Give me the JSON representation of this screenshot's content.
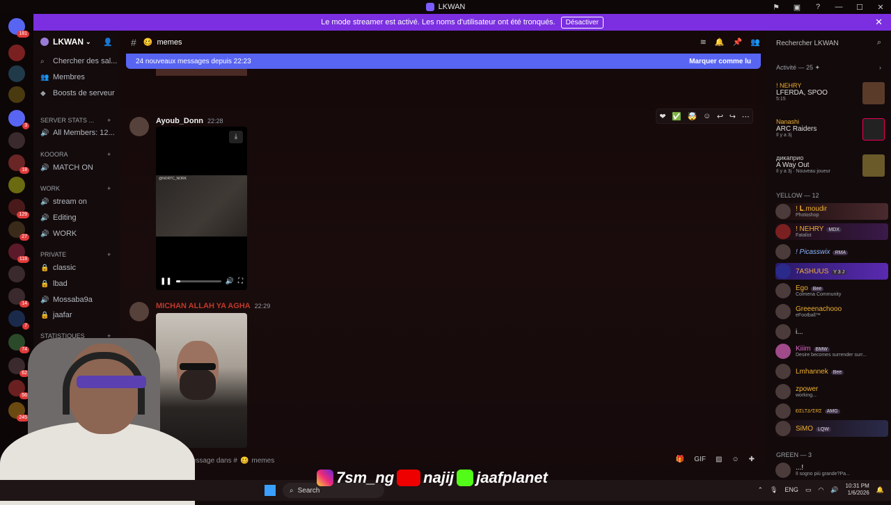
{
  "window": {
    "title": "LKWAN"
  },
  "banner": {
    "text": "Le mode streamer est activé. Les noms d'utilisateur ont été tronqués.",
    "button": "Désactiver"
  },
  "servers": [
    {
      "badge": "181"
    },
    {
      "badge": ""
    },
    {
      "badge": ""
    },
    {
      "badge": ""
    },
    {
      "badge": "3"
    },
    {
      "badge": ""
    },
    {
      "badge": "18"
    },
    {
      "badge": ""
    },
    {
      "badge": "129"
    },
    {
      "badge": "27"
    },
    {
      "badge": "118"
    },
    {
      "badge": ""
    },
    {
      "badge": "14"
    },
    {
      "badge": "7"
    },
    {
      "badge": "74"
    },
    {
      "badge": "62"
    },
    {
      "badge": "56"
    },
    {
      "badge": "245"
    }
  ],
  "guild": {
    "name": "LKWAN"
  },
  "sidebar": {
    "items": [
      {
        "label": "Chercher des sal..."
      },
      {
        "label": "Membres"
      },
      {
        "label": "Boosts de serveur"
      }
    ],
    "server_stats": "SERVER STATS ...",
    "all_members": "All Members: 12...",
    "kooora": "KOOORA",
    "match_on": "MATCH ON",
    "work": "work",
    "stream_on": "stream on",
    "editing": "Editing",
    "work_ch": "WORK",
    "private": "PRIVATE",
    "classic": "classic",
    "lbad": "lbad",
    "mossaba": "Mossaba9a",
    "jaafar": "jaafar",
    "statistiques": "STATISTIQUES"
  },
  "channel": {
    "name": "memes",
    "new_messages": "24 nouveaux messages depuis 22:23",
    "mark_read": "Marquer comme lu"
  },
  "messages": [
    {
      "author": "Ayoub_Donn",
      "time": "22:28",
      "video_watermark": "@NORTC_NORK"
    },
    {
      "author": "MICHAN ALLAH YA AGHA",
      "time": "22:29"
    }
  ],
  "input": {
    "placeholder": "er un message dans #",
    "channel": "memes"
  },
  "members": {
    "search": "Rechercher LKWAN",
    "activity_header": "Activité — 25",
    "activities": [
      {
        "name": "! NEHRY",
        "title": "LFERDA, SPOO",
        "sub": "5:15"
      },
      {
        "name": "Nanashi",
        "title": "ARC Raiders",
        "sub": "Il y a 3j"
      },
      {
        "name": "дикаприо",
        "title": "A Way Out",
        "sub": "Il y a 3j · Nouveau joueur"
      }
    ],
    "yellow_header": "YELLOW — 12",
    "yellow": [
      {
        "name": "! 𝐋.moudir",
        "status": "Photoshop",
        "tag": ""
      },
      {
        "name": "! NEHRY",
        "status": "Fatalist",
        "tag": "MDX"
      },
      {
        "name": "! Picasswix",
        "status": "",
        "tag": "RMA"
      },
      {
        "name": "7ASHUUS",
        "status": "",
        "tag": "Y 3 J"
      },
      {
        "name": "Ego",
        "status": "Colmena Community",
        "tag": "Bee"
      },
      {
        "name": "Greeenachooo",
        "status": "eFootball™",
        "tag": ""
      },
      {
        "name": "i...",
        "status": "",
        "tag": ""
      },
      {
        "name": "Kiiim",
        "status": "Desire becomes surrender surr...",
        "tag": "BMW"
      },
      {
        "name": "Lmhannek",
        "status": "",
        "tag": "Bee"
      },
      {
        "name": "zpower",
        "status": "working...",
        "tag": ""
      },
      {
        "name": "ĐΣLTΔ²ΣRΣ",
        "status": "",
        "tag": "AMG"
      },
      {
        "name": "SiMO",
        "status": "",
        "tag": "LQW"
      }
    ],
    "green_header": "GREEN — 3",
    "green": [
      {
        "name": "...!",
        "status": "Il sogno più grande?Pa..."
      }
    ]
  },
  "taskbar": {
    "search": "Search",
    "lang": "ENG",
    "time": "10:31 PM",
    "date": "1/6/2026"
  },
  "socials": {
    "instagram": "7sm_ng",
    "youtube": "najij",
    "kick": "jaafplanet"
  },
  "colors": {
    "banner": "#7b2fe0",
    "new_bar": "#5865f2",
    "accent_yellow": "#f0b232"
  }
}
